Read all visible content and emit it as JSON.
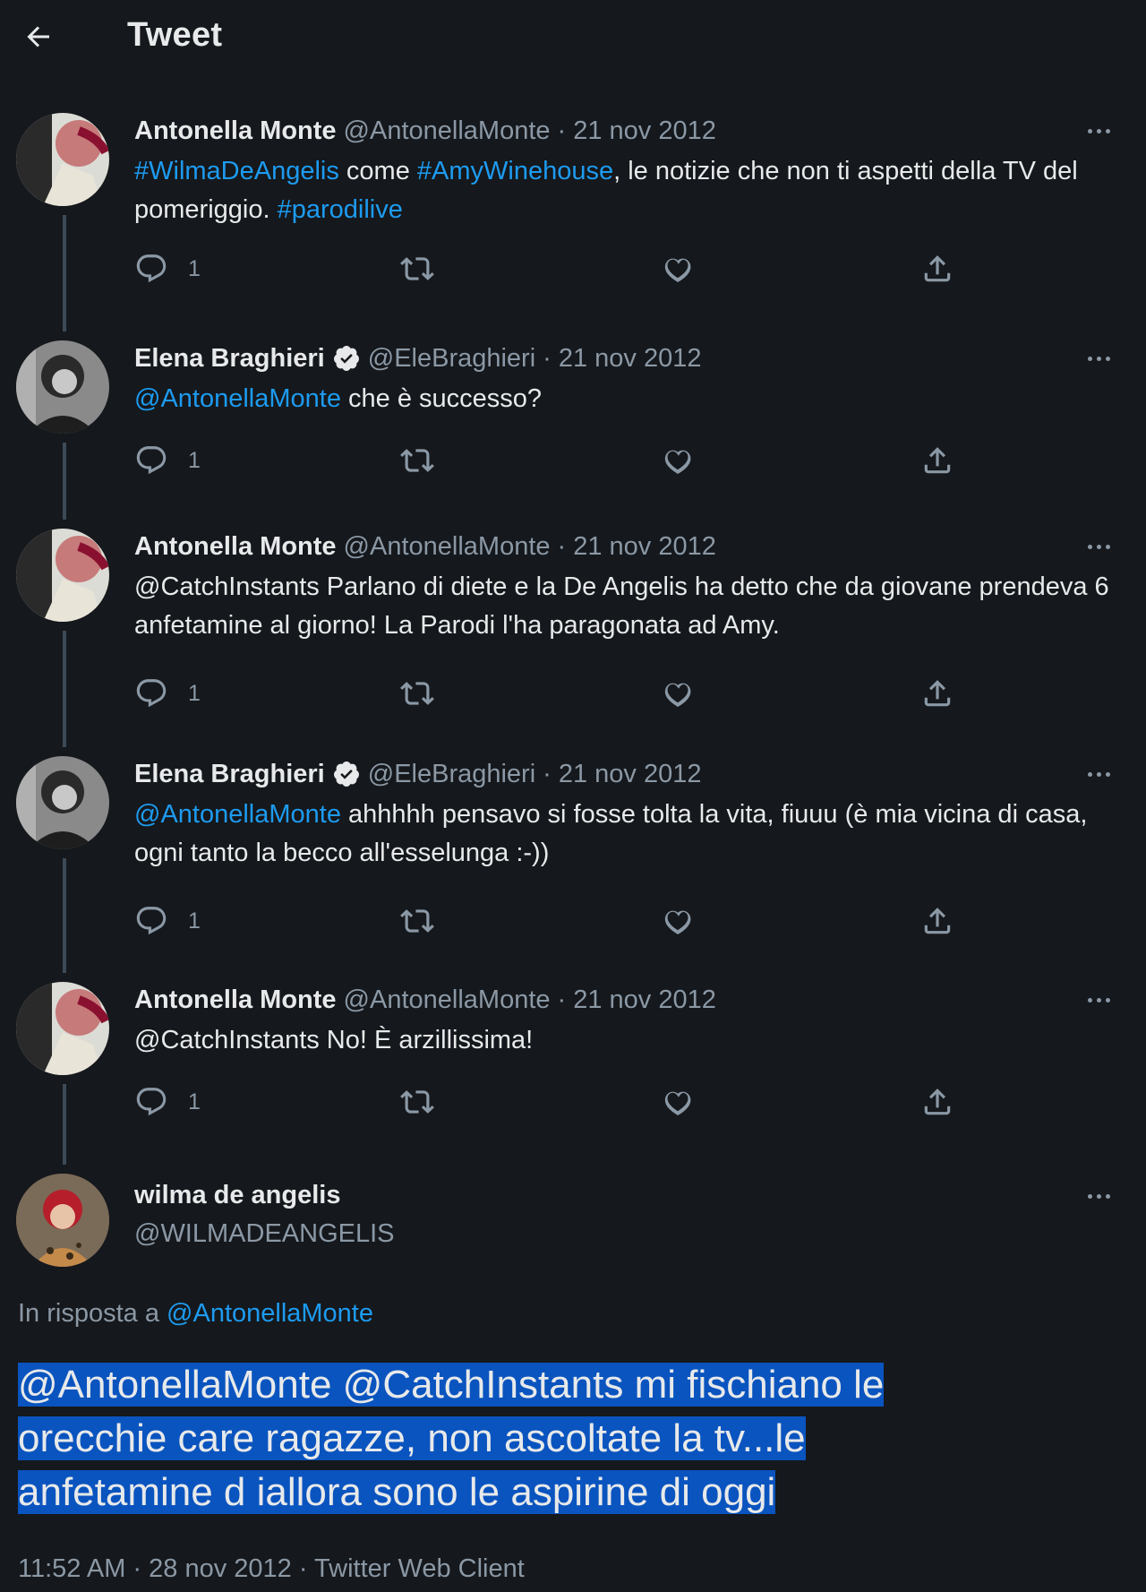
{
  "header": {
    "title": "Tweet",
    "back_icon": "arrow-left-icon"
  },
  "thread": [
    {
      "name": "Antonella Monte",
      "verified": false,
      "handle": "@AntonellaMonte",
      "date": "21 nov 2012",
      "text_parts": [
        {
          "t": "#WilmaDeAngelis",
          "link": true
        },
        {
          "t": " come ",
          "link": false
        },
        {
          "t": "#AmyWinehouse",
          "link": true
        },
        {
          "t": ", le notizie che non ti aspetti della TV del pomeriggio. ",
          "link": false
        },
        {
          "t": "#parodilive",
          "link": true
        }
      ],
      "replies": "1"
    },
    {
      "name": "Elena Braghieri",
      "verified": true,
      "handle": "@EleBraghieri",
      "date": "21 nov 2012",
      "text_parts": [
        {
          "t": "@AntonellaMonte",
          "link": true
        },
        {
          "t": " che è successo?",
          "link": false
        }
      ],
      "replies": "1"
    },
    {
      "name": "Antonella Monte",
      "verified": false,
      "handle": "@AntonellaMonte",
      "date": "21 nov 2012",
      "text_parts": [
        {
          "t": "@CatchInstants Parlano di diete e la De Angelis ha detto che da giovane prendeva 6 anfetamine al giorno! La Parodi l'ha paragonata ad Amy.",
          "link": false
        }
      ],
      "replies": "1"
    },
    {
      "name": "Elena Braghieri",
      "verified": true,
      "handle": "@EleBraghieri",
      "date": "21 nov 2012",
      "text_parts": [
        {
          "t": "@AntonellaMonte",
          "link": true
        },
        {
          "t": " ahhhhh pensavo si fosse tolta la vita, fiuuu (è mia vicina di casa, ogni tanto la becco all'esselunga :-))",
          "link": false
        }
      ],
      "replies": "1"
    },
    {
      "name": "Antonella Monte",
      "verified": false,
      "handle": "@AntonellaMonte",
      "date": "21 nov 2012",
      "text_parts": [
        {
          "t": "@CatchInstants No! È arzillissima!",
          "link": false
        }
      ],
      "replies": "1"
    }
  ],
  "main_tweet": {
    "name": "wilma de angelis",
    "handle": "@WILMADEANGELIS",
    "reply_label": "In risposta a ",
    "reply_handle": "@AntonellaMonte",
    "text_lines": [
      "@AntonellaMonte @CatchInstants mi fischiano le",
      "orecchie care ragazze, non ascoltate la tv...le",
      "anfetamine d iallora sono le aspirine di oggi"
    ],
    "timestamp": "11:52 AM · 28 nov 2012 · Twitter Web Client"
  },
  "icons": {
    "reply": "reply-icon",
    "retweet": "retweet-icon",
    "like": "heart-icon",
    "share": "share-icon",
    "more": "more-icon",
    "verified": "verified-badge-icon"
  },
  "colors": {
    "background": "#15181c",
    "link": "#1d9bf0",
    "secondary": "#8b98a5",
    "highlight": "#0a54bf"
  }
}
